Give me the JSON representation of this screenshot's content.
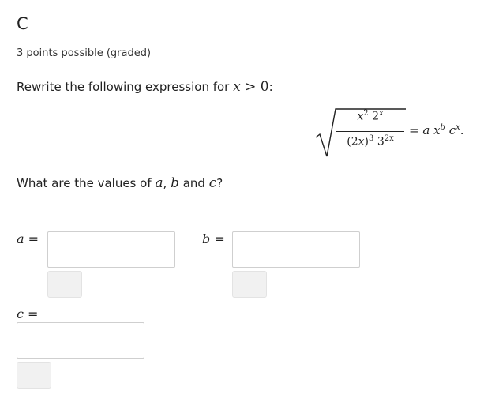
{
  "problem": {
    "title": "C",
    "points": "3 points possible (graded)",
    "prompt_prefix": "Rewrite the following expression for ",
    "prompt_condition_var": "x",
    "prompt_condition_rel": " > 0",
    "prompt_suffix": ":",
    "question_prefix": "What are the values of ",
    "question_vars": [
      "a",
      "b",
      "c"
    ],
    "question_sep": ", ",
    "question_and": " and ",
    "question_suffix": "?"
  },
  "equation": {
    "numerator": {
      "x": "x",
      "x_exp": "2",
      "base": "2",
      "base_exp": "x"
    },
    "denominator": {
      "open": "(2",
      "var": "x",
      "close": ")",
      "exp": "3",
      "base": "3",
      "base_exp": "2x"
    },
    "rhs": {
      "equals": "= ",
      "a": "a",
      "x": "x",
      "x_exp": "b",
      "c": "c",
      "c_exp": "x",
      "end": "."
    }
  },
  "fields": {
    "a": {
      "var": "a",
      "eq": " =",
      "value": "",
      "placeholder": ""
    },
    "b": {
      "var": "b",
      "eq": " =",
      "value": "",
      "placeholder": ""
    },
    "c": {
      "var": "c",
      "eq": " =",
      "value": "",
      "placeholder": ""
    }
  }
}
